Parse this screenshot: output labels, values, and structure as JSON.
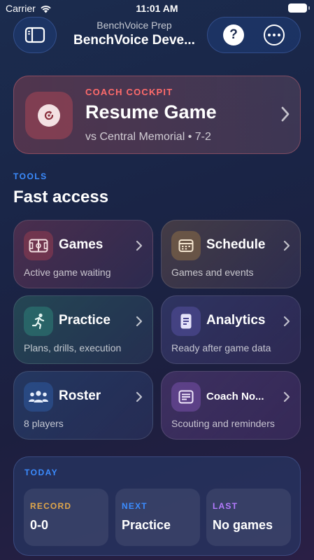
{
  "status_bar": {
    "carrier": "Carrier",
    "time": "11:01 AM"
  },
  "header": {
    "subtitle": "BenchVoice Prep",
    "title": "BenchVoice Deve...",
    "help_glyph": "?"
  },
  "hero": {
    "eyebrow": "COACH COCKPIT",
    "title": "Resume Game",
    "subtitle": "vs Central Memorial • 7-2",
    "accent": "#ff6b6b"
  },
  "tools": {
    "eyebrow": "TOOLS",
    "title": "Fast access",
    "tiles": [
      {
        "label": "Games",
        "subtitle": "Active game waiting",
        "icon": "scoreboard-icon"
      },
      {
        "label": "Schedule",
        "subtitle": "Games and events",
        "icon": "calendar-icon"
      },
      {
        "label": "Practice",
        "subtitle": "Plans, drills, execution",
        "icon": "runner-icon"
      },
      {
        "label": "Analytics",
        "subtitle": "Ready after game data",
        "icon": "document-icon"
      },
      {
        "label": "Roster",
        "subtitle": "8 players",
        "icon": "people-icon"
      },
      {
        "label": "Coach No...",
        "subtitle": "Scouting and reminders",
        "icon": "notes-icon"
      }
    ]
  },
  "today": {
    "eyebrow": "TODAY",
    "stats": [
      {
        "label": "RECORD",
        "value": "0-0",
        "color": "#e0a64a"
      },
      {
        "label": "NEXT",
        "value": "Practice",
        "color": "#3b8cff"
      },
      {
        "label": "LAST",
        "value": "No games",
        "color": "#b57bff"
      }
    ]
  }
}
